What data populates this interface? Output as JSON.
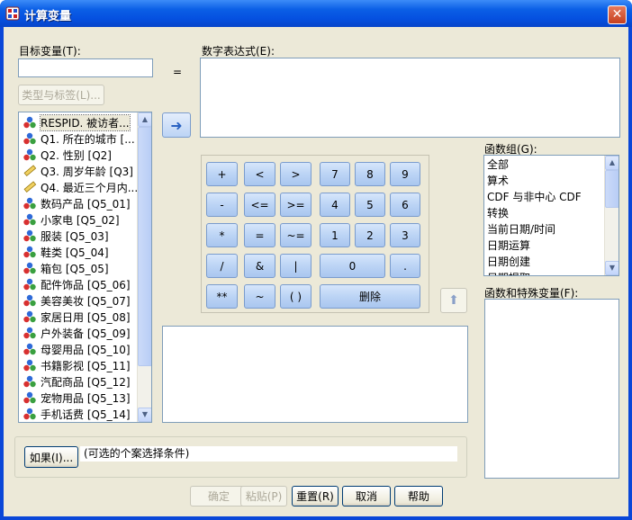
{
  "window": {
    "title": "计算变量",
    "close_glyph": "✕"
  },
  "target": {
    "label": "目标变量(T):",
    "value": "",
    "type_button": "类型与标签(L)..."
  },
  "equals": "=",
  "expression": {
    "label": "数字表达式(E):",
    "value": ""
  },
  "transfer_glyph": "➜",
  "up_glyph": "⬆",
  "variables": [
    {
      "label": "RESPID. 被访者...",
      "kind": "nominal"
    },
    {
      "label": "Q1. 所在的城市 [...",
      "kind": "nominal"
    },
    {
      "label": "Q2. 性别 [Q2]",
      "kind": "nominal"
    },
    {
      "label": "Q3. 周岁年龄 [Q3]",
      "kind": "scale"
    },
    {
      "label": "Q4. 最近三个月内...",
      "kind": "scale"
    },
    {
      "label": "数码产品 [Q5_01]",
      "kind": "nominal"
    },
    {
      "label": "小家电 [Q5_02]",
      "kind": "nominal"
    },
    {
      "label": "服装 [Q5_03]",
      "kind": "nominal"
    },
    {
      "label": "鞋类 [Q5_04]",
      "kind": "nominal"
    },
    {
      "label": "箱包 [Q5_05]",
      "kind": "nominal"
    },
    {
      "label": "配件饰品 [Q5_06]",
      "kind": "nominal"
    },
    {
      "label": "美容美妆 [Q5_07]",
      "kind": "nominal"
    },
    {
      "label": "家居日用 [Q5_08]",
      "kind": "nominal"
    },
    {
      "label": "户外装备 [Q5_09]",
      "kind": "nominal"
    },
    {
      "label": "母婴用品 [Q5_10]",
      "kind": "nominal"
    },
    {
      "label": "书籍影视 [Q5_11]",
      "kind": "nominal"
    },
    {
      "label": "汽配商品 [Q5_12]",
      "kind": "nominal"
    },
    {
      "label": "宠物用品 [Q5_13]",
      "kind": "nominal"
    },
    {
      "label": "手机话费 [Q5_14]",
      "kind": "nominal"
    }
  ],
  "keypad": {
    "plus": "+",
    "lt": "<",
    "gt": ">",
    "k7": "7",
    "k8": "8",
    "k9": "9",
    "minus": "-",
    "le": "<=",
    "ge": ">=",
    "k4": "4",
    "k5": "5",
    "k6": "6",
    "times": "*",
    "eq": "=",
    "ne": "~=",
    "k1": "1",
    "k2": "2",
    "k3": "3",
    "divide": "/",
    "and": "&",
    "or": "|",
    "k0": "0",
    "dot": ".",
    "power": "**",
    "not": "~",
    "paren": "( )",
    "delete": "删除"
  },
  "function_group": {
    "label": "函数组(G):",
    "items": [
      "全部",
      "算术",
      "CDF 与非中心 CDF",
      "转换",
      "当前日期/时间",
      "日期运算",
      "日期创建",
      "日期提取"
    ]
  },
  "functions": {
    "label": "函数和特殊变量(F):"
  },
  "if_section": {
    "button": "如果(I)...",
    "text": "(可选的个案选择条件)"
  },
  "footer": {
    "ok": "确定",
    "paste": "粘贴(P)",
    "reset": "重置(R)",
    "cancel": "取消",
    "help": "帮助"
  },
  "colors": {
    "title_bar": "#0b5fe6",
    "face": "#ece9d8",
    "keypad_blue": "#bcd4f5"
  }
}
